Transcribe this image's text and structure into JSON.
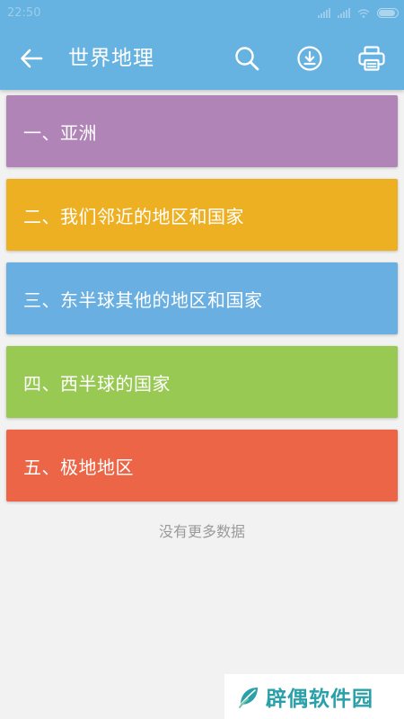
{
  "status_bar": {
    "time": "22:50",
    "battery_level": 0.9
  },
  "header": {
    "title": "世界地理",
    "back_icon": "arrow-left-icon",
    "actions": [
      {
        "icon": "search-icon"
      },
      {
        "icon": "download-icon"
      },
      {
        "icon": "print-icon"
      }
    ],
    "bar_color": "#66b2e0"
  },
  "sections": [
    {
      "label": "一、亚洲",
      "color": "#b184b7"
    },
    {
      "label": "二、我们邻近的地区和国家",
      "color": "#eeb023"
    },
    {
      "label": "三、东半球其他的地区和国家",
      "color": "#6aafe1"
    },
    {
      "label": "四、西半球的国家",
      "color": "#97c953"
    },
    {
      "label": "五、极地地区",
      "color": "#ec6547"
    }
  ],
  "footer": {
    "no_more": "没有更多数据"
  },
  "watermark": {
    "text": "辟偶软件园",
    "color": "#2aa0a8"
  }
}
